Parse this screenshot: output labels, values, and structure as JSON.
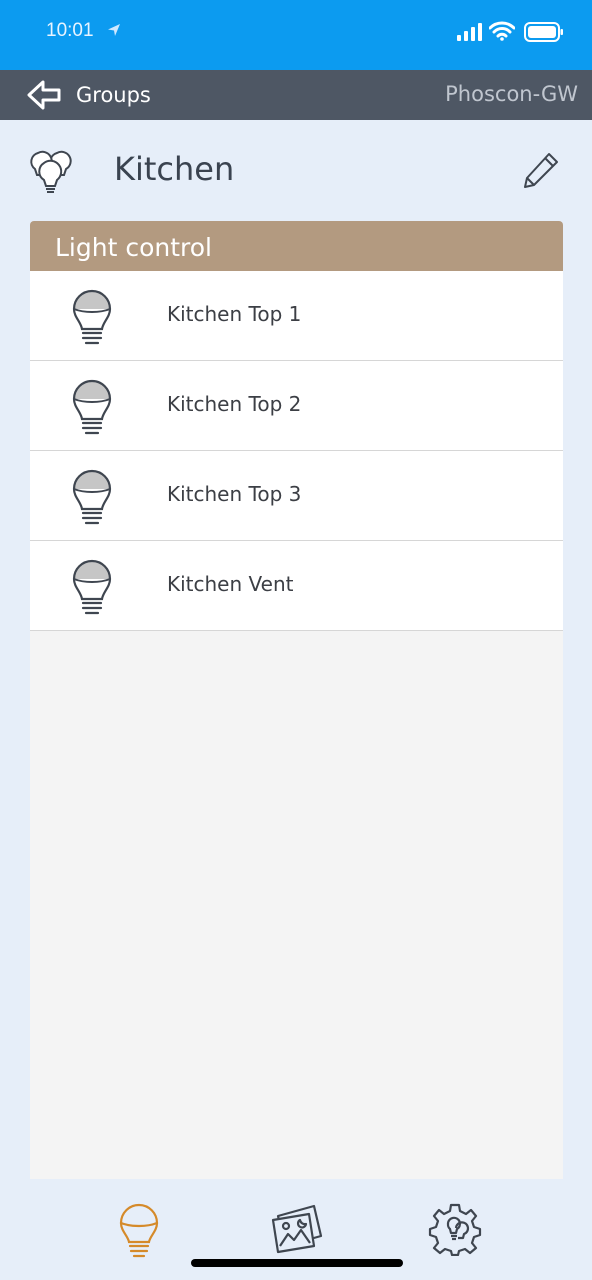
{
  "status": {
    "time": "10:01"
  },
  "nav": {
    "back_label": "Groups",
    "title": "Phoscon-GW"
  },
  "header": {
    "title": "Kitchen",
    "group_icon": "bulbs-group-icon",
    "edit_icon": "pencil-icon"
  },
  "panel": {
    "title": "Light control",
    "lights": [
      {
        "name": "Kitchen Top 1"
      },
      {
        "name": "Kitchen Top 2"
      },
      {
        "name": "Kitchen Top 3"
      },
      {
        "name": "Kitchen Vent"
      }
    ]
  },
  "tabbar": {
    "tabs": [
      {
        "icon": "bulb-icon",
        "active": true
      },
      {
        "icon": "scenes-icon",
        "active": false
      },
      {
        "icon": "settings-gear-icon",
        "active": false
      }
    ]
  },
  "colors": {
    "status_bar": "#0c9bf0",
    "nav_bar": "#4e5764",
    "panel_header": "#b39a80",
    "background": "#e6eef9",
    "active_tab": "#d58a2a"
  }
}
